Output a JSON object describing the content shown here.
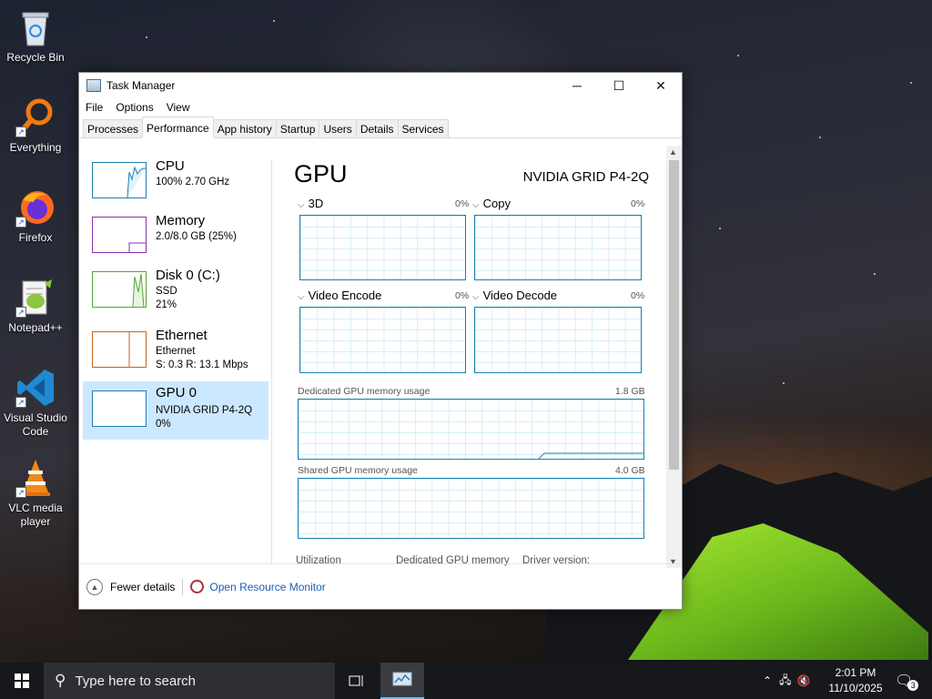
{
  "desktop": {
    "icons": [
      {
        "label": "Recycle Bin",
        "icon": "recycle-bin-icon"
      },
      {
        "label": "Everything",
        "icon": "everything-search-icon"
      },
      {
        "label": "Firefox",
        "icon": "firefox-icon"
      },
      {
        "label": "Notepad++",
        "icon": "notepad-plus-plus-icon"
      },
      {
        "label": "Visual Studio Code",
        "icon": "vscode-icon"
      },
      {
        "label": "VLC media player",
        "icon": "vlc-icon"
      }
    ]
  },
  "window": {
    "title": "Task Manager",
    "controls": {
      "minimize": "─",
      "maximize": "☐",
      "close": "✕"
    },
    "menu": [
      "File",
      "Options",
      "View"
    ],
    "tabs": [
      "Processes",
      "Performance",
      "App history",
      "Startup",
      "Users",
      "Details",
      "Services"
    ],
    "active_tab": "Performance",
    "resources": [
      {
        "name": "CPU",
        "line1": "100%  2.70 GHz",
        "line2": "",
        "color": "#1b7fb0"
      },
      {
        "name": "Memory",
        "line1": "2.0/8.0 GB (25%)",
        "line2": "",
        "color": "#8b2fae"
      },
      {
        "name": "Disk 0 (C:)",
        "line1": "SSD",
        "line2": "21%",
        "color": "#4da833"
      },
      {
        "name": "Ethernet",
        "line1": "Ethernet",
        "line2": "S: 0.3  R: 13.1 Mbps",
        "color": "#c8621d"
      },
      {
        "name": "GPU 0",
        "line1": "NVIDIA GRID P4-2Q",
        "line2": "0%",
        "color": "#1b7fb0",
        "selected": true
      }
    ],
    "gpu": {
      "title": "GPU",
      "model": "NVIDIA GRID P4-2Q",
      "engines": [
        {
          "label": "3D",
          "pct": "0%"
        },
        {
          "label": "Copy",
          "pct": "0%"
        },
        {
          "label": "Video Encode",
          "pct": "0%"
        },
        {
          "label": "Video Decode",
          "pct": "0%"
        }
      ],
      "dedicated": {
        "label": "Dedicated GPU memory usage",
        "max": "1.8 GB"
      },
      "shared": {
        "label": "Shared GPU memory usage",
        "max": "4.0 GB"
      },
      "stats": {
        "utilization": "Utilization",
        "dedicated_memory": "Dedicated GPU memory",
        "driver_version": "Driver version:"
      }
    },
    "footer": {
      "fewer_details": "Fewer details",
      "open_resource_monitor": "Open Resource Monitor"
    }
  },
  "taskbar": {
    "search_placeholder": "Type here to search",
    "time": "2:01 PM",
    "date": "11/10/2025",
    "notification_count": "3",
    "accent": "#76b9ed"
  }
}
